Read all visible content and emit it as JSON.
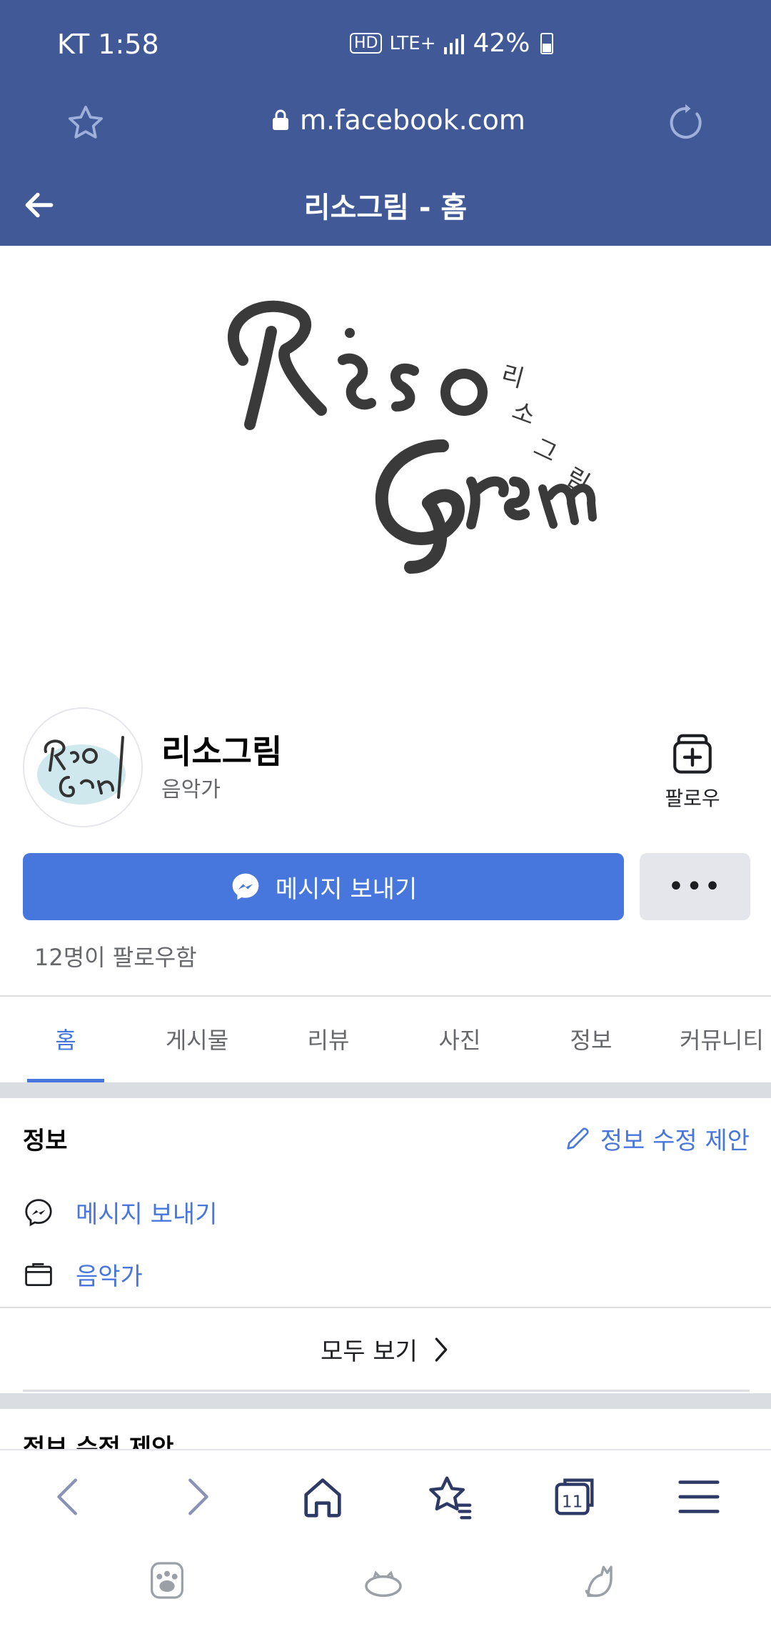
{
  "status_bar": {
    "carrier": "KT",
    "time": "1:58",
    "hd": "HD",
    "network": "LTE+",
    "battery": "42%"
  },
  "browser": {
    "url": "m.facebook.com"
  },
  "header": {
    "title": "리소그림 - 홈"
  },
  "page": {
    "name": "리소그림",
    "category": "음악가",
    "follow_label": "팔로우",
    "message_button": "메시지 보내기",
    "more_label": "•••",
    "followers_text": "12명이 팔로우함"
  },
  "tabs": [
    "홈",
    "게시물",
    "리뷰",
    "사진",
    "정보",
    "커뮤니티"
  ],
  "info": {
    "heading": "정보",
    "suggest_edit": "정보 수정 제안",
    "rows": [
      "메시지 보내기",
      "음악가"
    ],
    "see_all": "모두 보기"
  },
  "next_section_heading": "정보 수정 제안",
  "colors": {
    "header_blue": "#415a97",
    "accent_blue": "#4777dd",
    "gray_text": "#65676b"
  }
}
